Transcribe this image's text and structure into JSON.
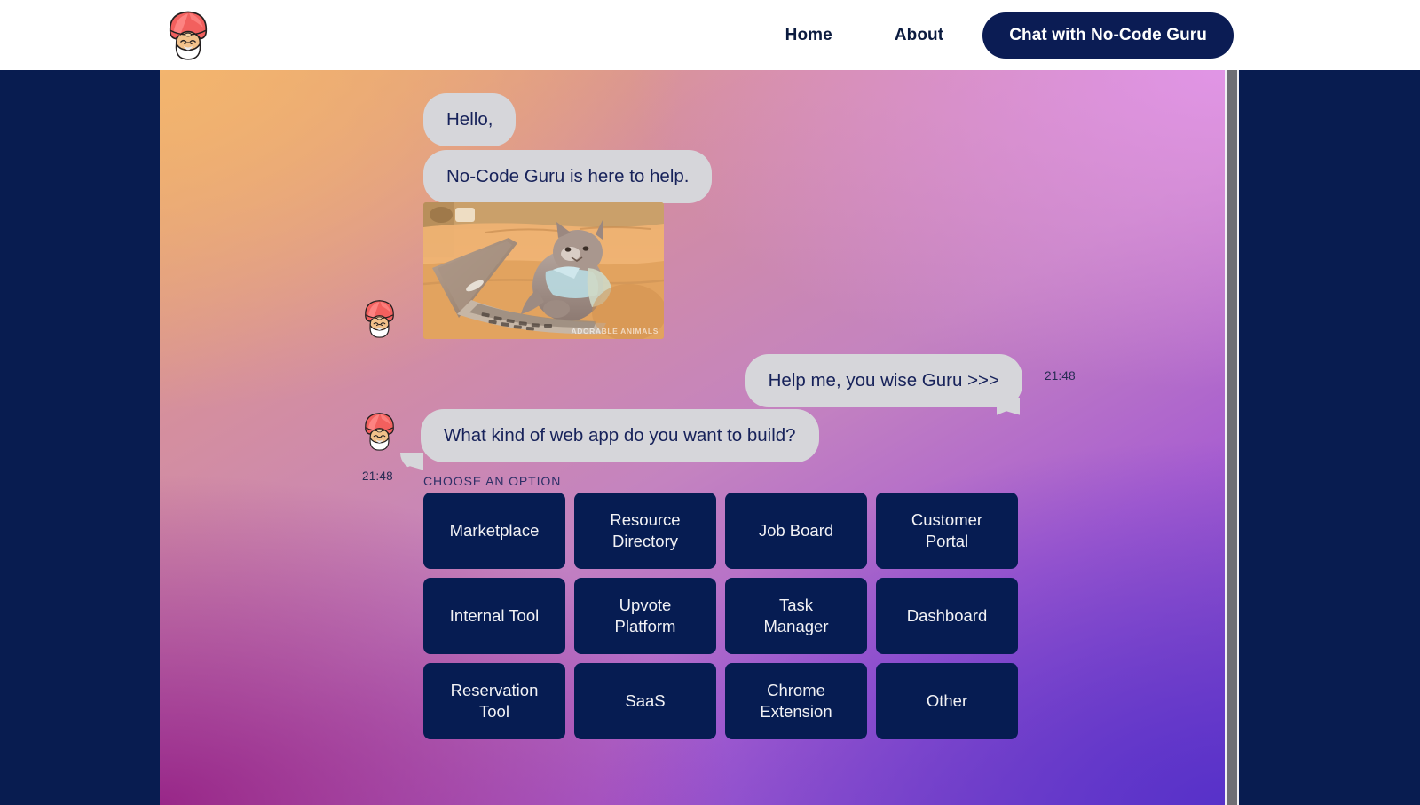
{
  "nav": {
    "logo_icon": "guru-turban-avatar-icon",
    "links": [
      {
        "label": "Home"
      },
      {
        "label": "About"
      }
    ],
    "cta_label": "Chat with No-Code Guru"
  },
  "chat": {
    "messages": [
      {
        "id": "hello",
        "from": "bot",
        "text": "Hello,"
      },
      {
        "id": "help",
        "from": "bot",
        "text": "No-Code Guru is here to help."
      },
      {
        "id": "cat",
        "from": "bot",
        "type": "image",
        "alt": "Cat typing on a laptop on a tan leather couch",
        "watermark": "ADORABLE ANIMALS"
      },
      {
        "id": "user",
        "from": "user",
        "text": "Help me, you wise Guru >>>",
        "time": "21:48"
      },
      {
        "id": "ask",
        "from": "bot",
        "text": "What kind of web app do you want to build?",
        "time": "21:48"
      }
    ],
    "choose_label": "Choose an option",
    "options": [
      "Marketplace",
      "Resource\nDirectory",
      "Job Board",
      "Customer\nPortal",
      "Internal Tool",
      "Upvote\nPlatform",
      "Task\nManager",
      "Dashboard",
      "Reservation\nTool",
      "SaaS",
      "Chrome\nExtension",
      "Other"
    ]
  },
  "colors": {
    "navy": "#061c52",
    "nav_cta_bg": "#0b1c54",
    "bubble_bg": "#d6d6da",
    "bubble_text": "#17225a",
    "option_text": "#f2f2f5",
    "page_bg": "#081c50",
    "scrollbar_thumb": "#6e6e74"
  }
}
